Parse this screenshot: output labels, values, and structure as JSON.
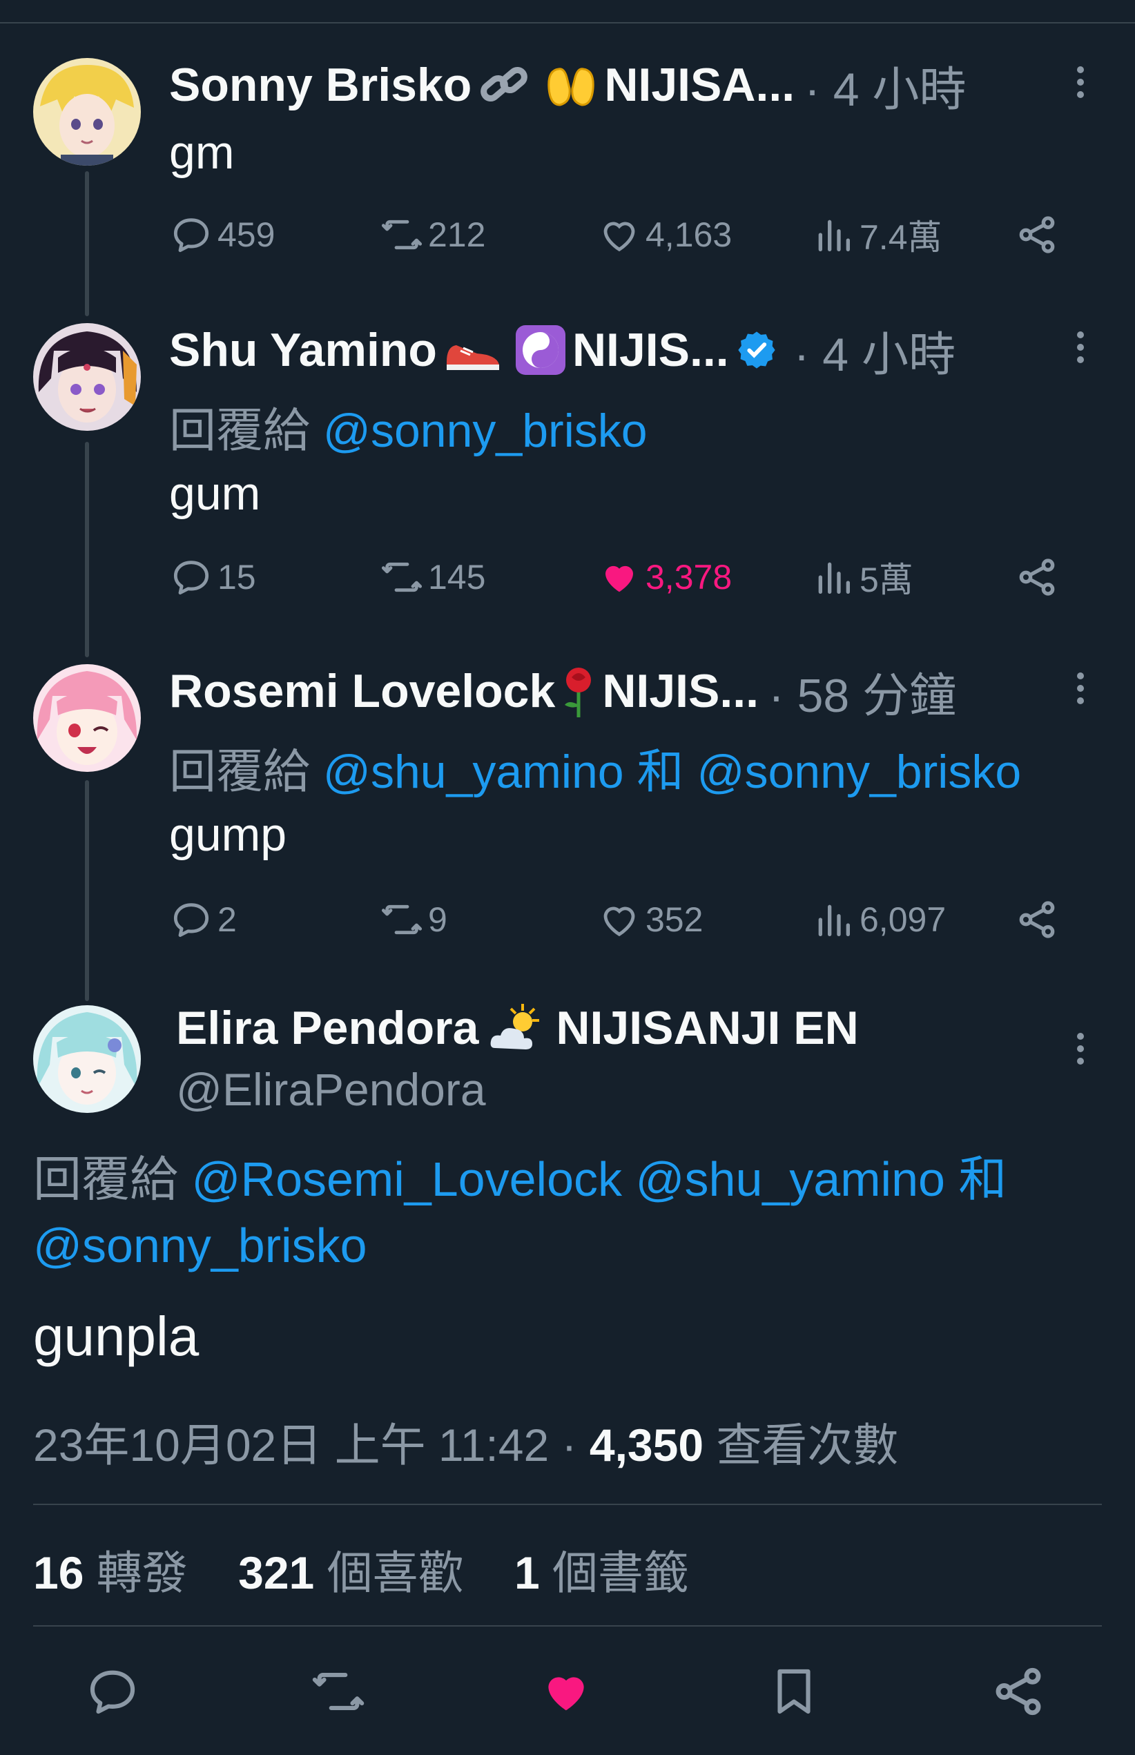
{
  "colors": {
    "background": "#15202b",
    "text": "#f7f9f9",
    "muted": "#8b98a5",
    "link": "#1d9bf0",
    "like": "#f91880",
    "verified": "#1d9bf0",
    "divider": "#38444d"
  },
  "thread": [
    {
      "name": "Sonny Brisko",
      "emojis": [
        "link-emoji",
        "raised-hands-emoji"
      ],
      "affiliation": "NIJISA...",
      "time": "· 4 小時",
      "reply_label": "",
      "mentions": [],
      "text": "gm",
      "replies": "459",
      "retweets": "212",
      "likes": "4,163",
      "views": "7.4萬",
      "liked": false
    },
    {
      "name": "Shu Yamino",
      "emojis": [
        "sneaker-emoji",
        "yin-yang-emoji"
      ],
      "affiliation": "NIJIS...",
      "verified": true,
      "time": "· 4 小時",
      "reply_label": "回覆給",
      "mention1": "@sonny_brisko",
      "text": "gum",
      "replies": "15",
      "retweets": "145",
      "likes": "3,378",
      "views": "5萬",
      "liked": true
    },
    {
      "name": "Rosemi Lovelock",
      "emojis": [
        "rose-emoji"
      ],
      "affiliation": "NIJIS...",
      "time": "· 58 分鐘",
      "reply_label": "回覆給",
      "mention1": "@shu_yamino",
      "joiner": "和",
      "mention2": "@sonny_brisko",
      "text": "gump",
      "replies": "2",
      "retweets": "9",
      "likes": "352",
      "views": "6,097",
      "liked": false
    }
  ],
  "main": {
    "name": "Elira Pendora",
    "emoji": "sun-cloud-emoji",
    "affiliation": "NIJISANJI EN",
    "handle": "@EliraPendora",
    "reply_label": "回覆給",
    "mention1": "@Rosemi_Lovelock",
    "mention2": "@shu_yamino",
    "joiner": "和",
    "mention3": "@sonny_brisko",
    "text": "gunpla",
    "date": "23年10月02日 上午 11:42",
    "sep": "·",
    "view_count": "4,350",
    "view_label": "查看次數",
    "retweet_count": "16",
    "retweet_label": "轉發",
    "like_count": "321",
    "like_label": "個喜歡",
    "bookmark_count": "1",
    "bookmark_label": "個書籤"
  }
}
